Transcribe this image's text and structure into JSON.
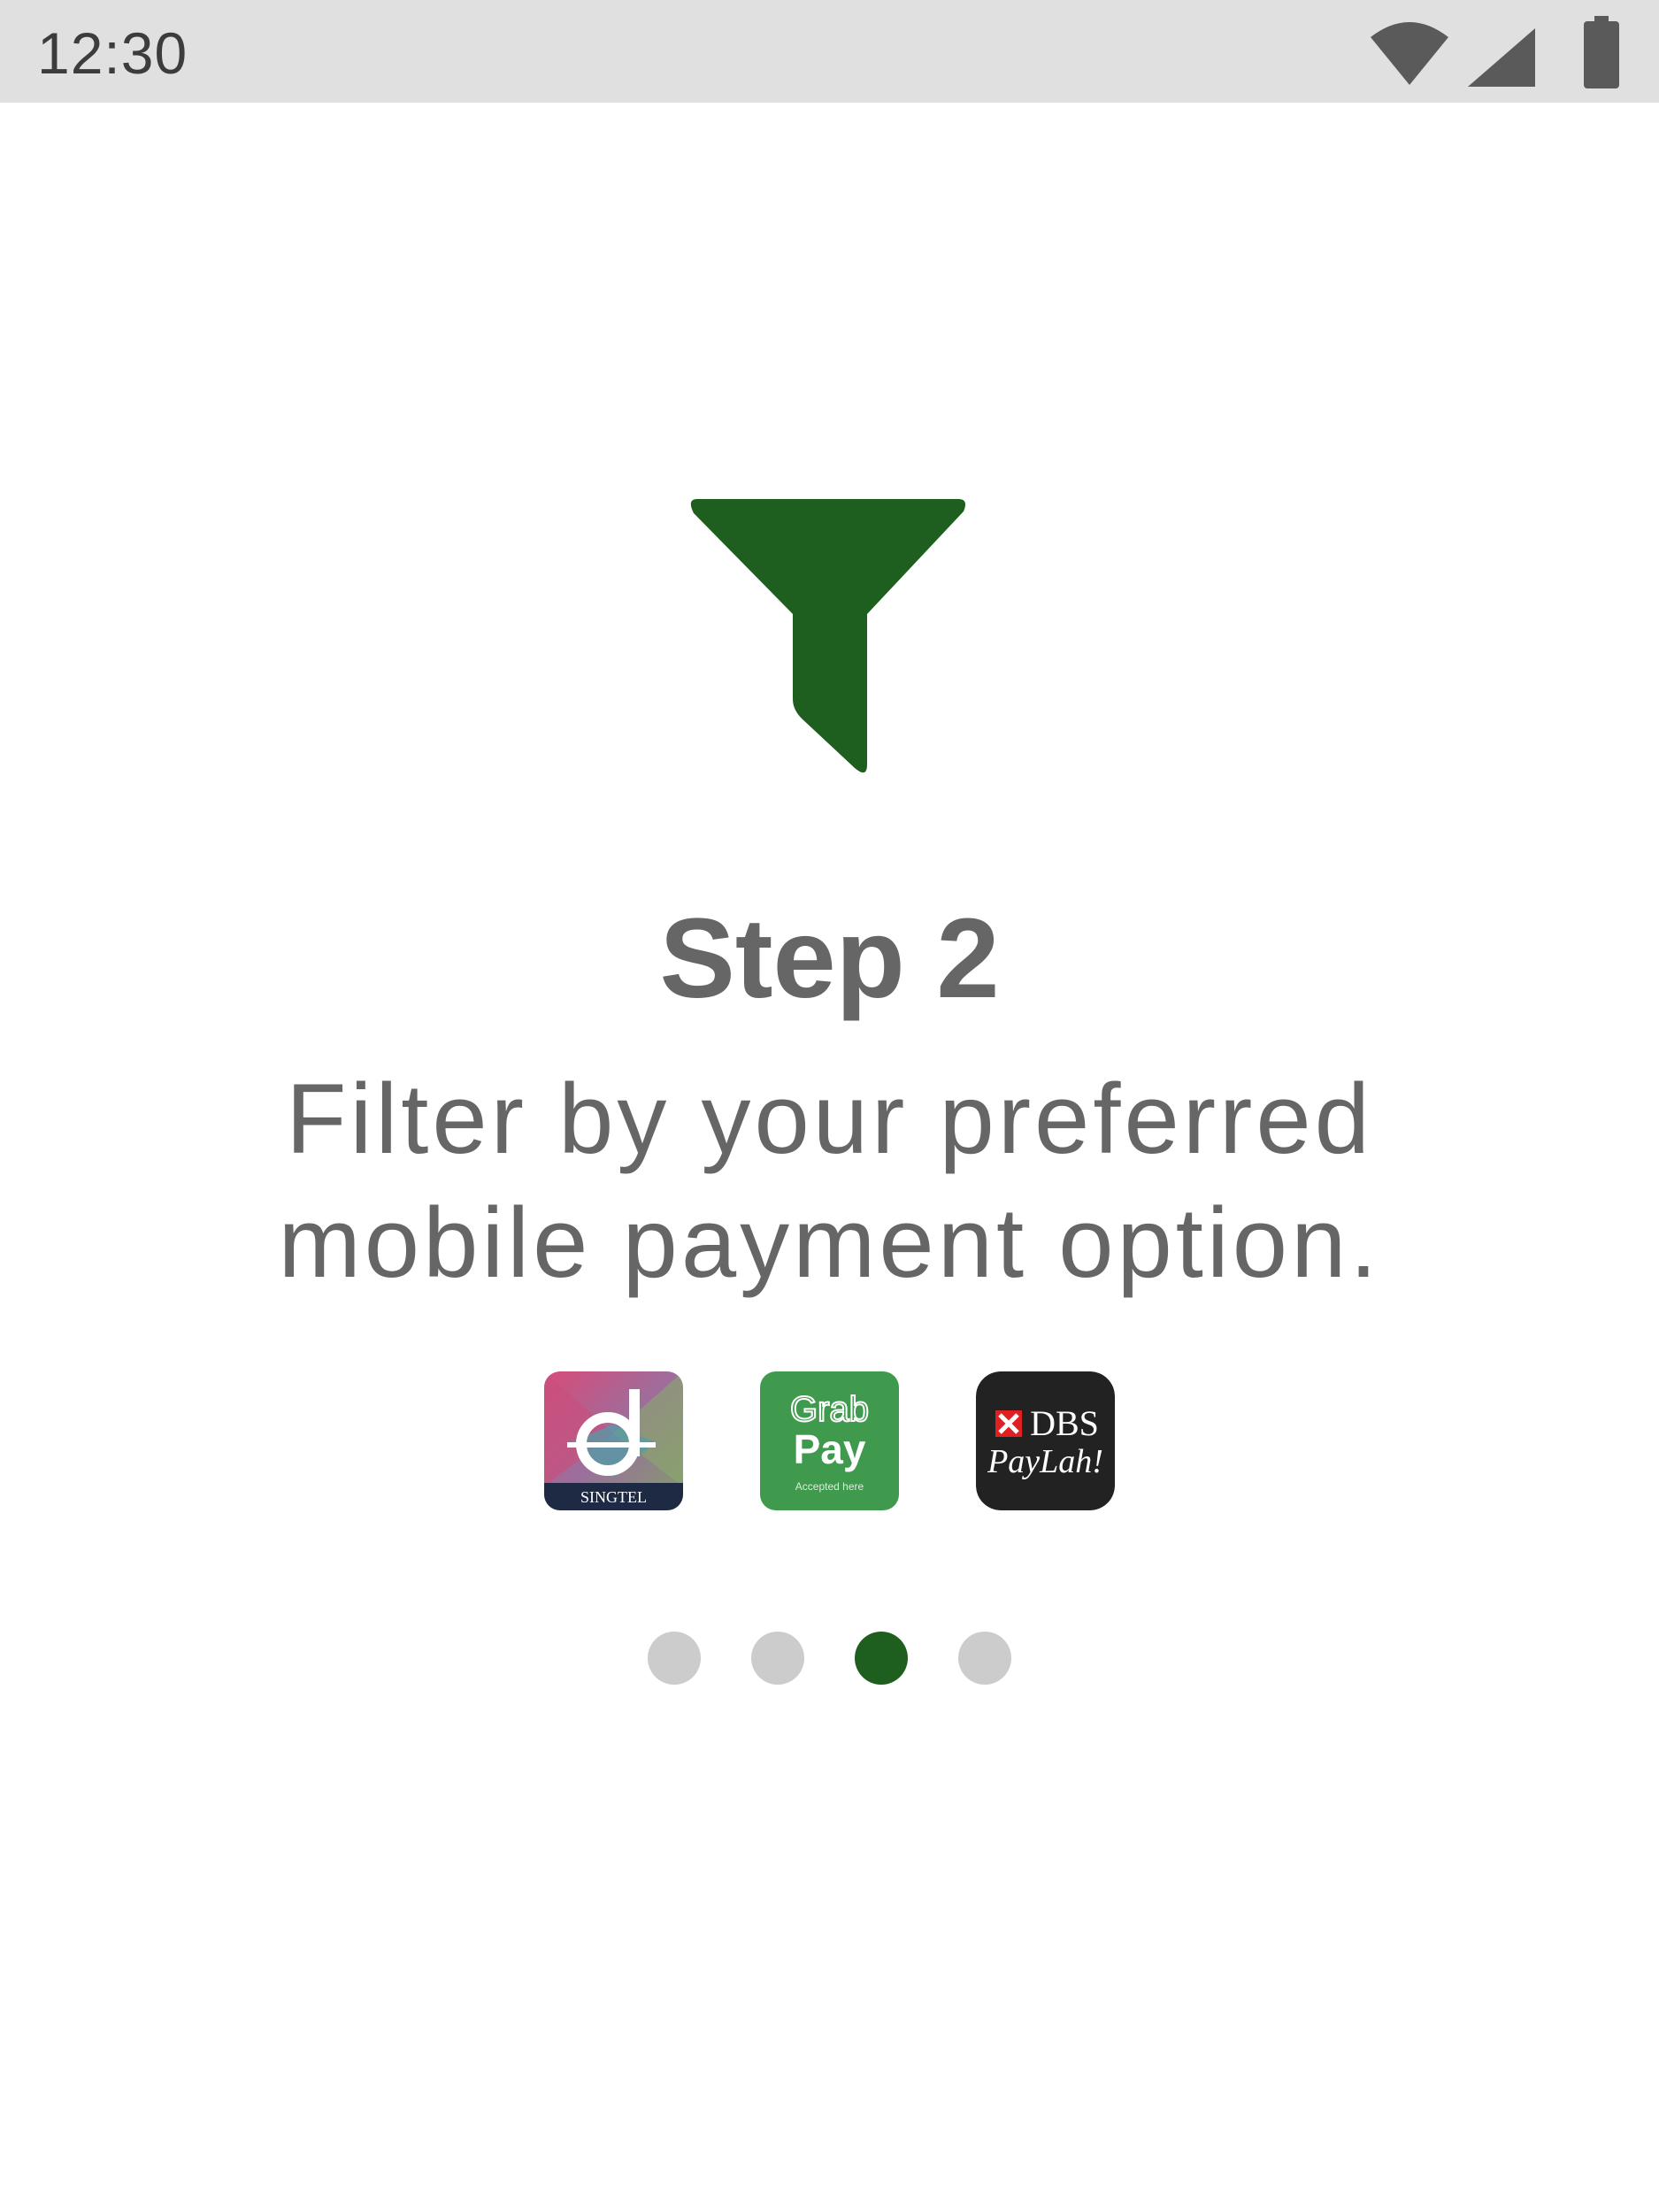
{
  "status_bar": {
    "time": "12:30",
    "icons": [
      "wifi-icon",
      "signal-icon",
      "battery-icon"
    ]
  },
  "onboarding": {
    "icon": "filter-icon",
    "icon_color": "#1e5f20",
    "title": "Step 2",
    "description_line1": "Filter by your preferred",
    "description_line2": "mobile payment option."
  },
  "payment_options": [
    {
      "icon": "singtel-dash-icon",
      "label": "SINGTEL"
    },
    {
      "icon": "grabpay-icon",
      "brand_line1": "Grab",
      "brand_line2": "Pay",
      "tagline": "Accepted here"
    },
    {
      "icon": "dbs-paylah-icon",
      "brand_line1": "DBS",
      "brand_line2": "PayLah!"
    }
  ],
  "pager": {
    "total_pages": 4,
    "current_page": 3,
    "active_color": "#1e5f20",
    "inactive_color": "#cccccc"
  }
}
